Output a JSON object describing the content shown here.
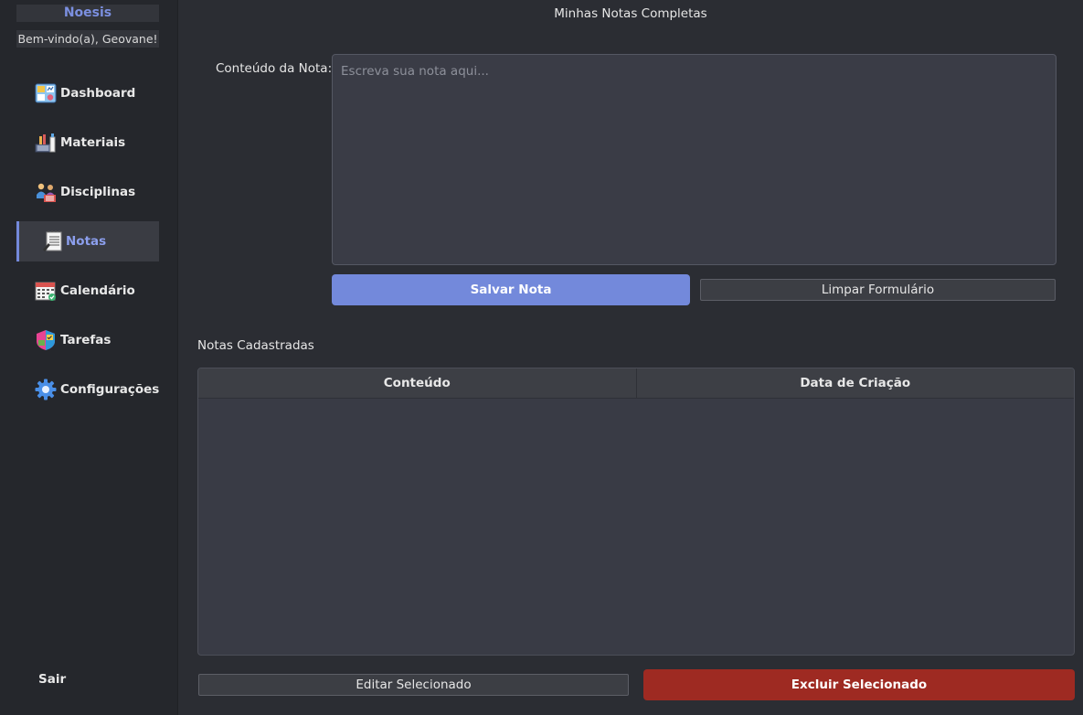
{
  "app": {
    "brand": "Noesis",
    "welcome": "Bem-vindo(a), Geovane!"
  },
  "sidebar": {
    "items": [
      {
        "label": "Dashboard",
        "icon": "dashboard-icon"
      },
      {
        "label": "Materiais",
        "icon": "materials-icon"
      },
      {
        "label": "Disciplinas",
        "icon": "disciplines-icon"
      },
      {
        "label": "Notas",
        "icon": "notes-icon",
        "active": true
      },
      {
        "label": "Calendário",
        "icon": "calendar-icon"
      },
      {
        "label": "Tarefas",
        "icon": "tasks-icon"
      },
      {
        "label": "Configurações",
        "icon": "gear-icon"
      }
    ],
    "logout": "Sair"
  },
  "main": {
    "title": "Minhas Notas Completas",
    "content_label": "Conteúdo da Nota:",
    "content_placeholder": "Escreva sua nota aqui...",
    "content_value": "",
    "save_button": "Salvar Nota",
    "clear_button": "Limpar Formulário",
    "list_label": "Notas Cadastradas",
    "table": {
      "columns": [
        "Conteúdo",
        "Data de Criação"
      ],
      "rows": []
    },
    "edit_button": "Editar Selecionado",
    "delete_button": "Excluir Selecionado"
  },
  "colors": {
    "accent": "#7389db",
    "danger": "#9e2a22",
    "background": "#2b2d33",
    "sidebar": "#25272c"
  }
}
